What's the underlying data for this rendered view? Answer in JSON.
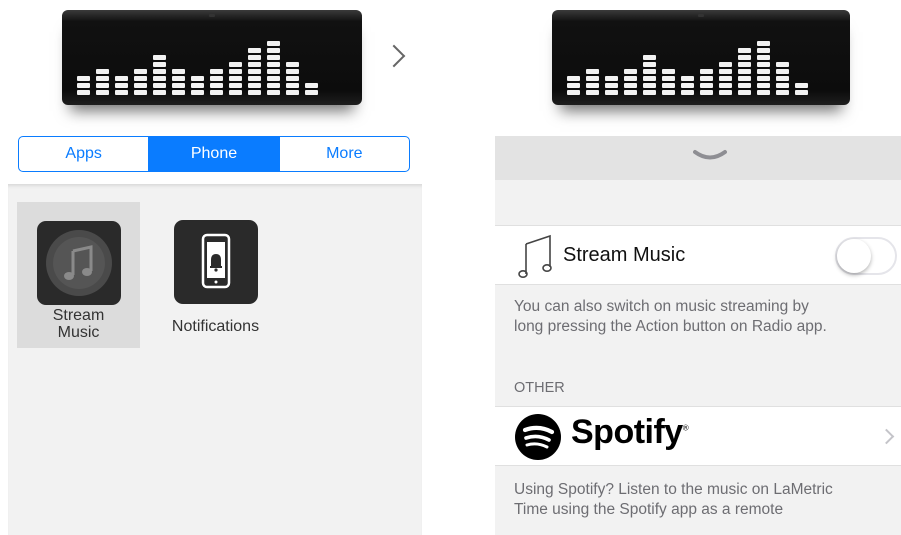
{
  "left": {
    "tabs": [
      {
        "label": "Apps",
        "active": false
      },
      {
        "label": "Phone",
        "active": true
      },
      {
        "label": "More",
        "active": false
      }
    ],
    "apps": [
      {
        "label_line1": "Stream",
        "label_line2": "Music",
        "icon": "music-note-icon",
        "selected": true
      },
      {
        "label": "Notifications",
        "icon": "phone-bell-icon",
        "selected": false
      }
    ],
    "next_icon": "chevron-right-icon"
  },
  "right": {
    "stream_music": {
      "label": "Stream Music",
      "toggle_on": false
    },
    "stream_desc_line1": "You can also switch on music streaming by",
    "stream_desc_line2": "long pressing the Action button on Radio app.",
    "section_other": "OTHER",
    "spotify": {
      "label": "Spotify",
      "mark": "®"
    },
    "spotify_desc_line1": "Using Spotify? Listen to the music on LaMetric",
    "spotify_desc_line2": "Time using the Spotify app as a remote"
  },
  "colors": {
    "accent": "#0a7cff",
    "spotify_black": "#000000",
    "background_gray": "#f2f2f2"
  }
}
